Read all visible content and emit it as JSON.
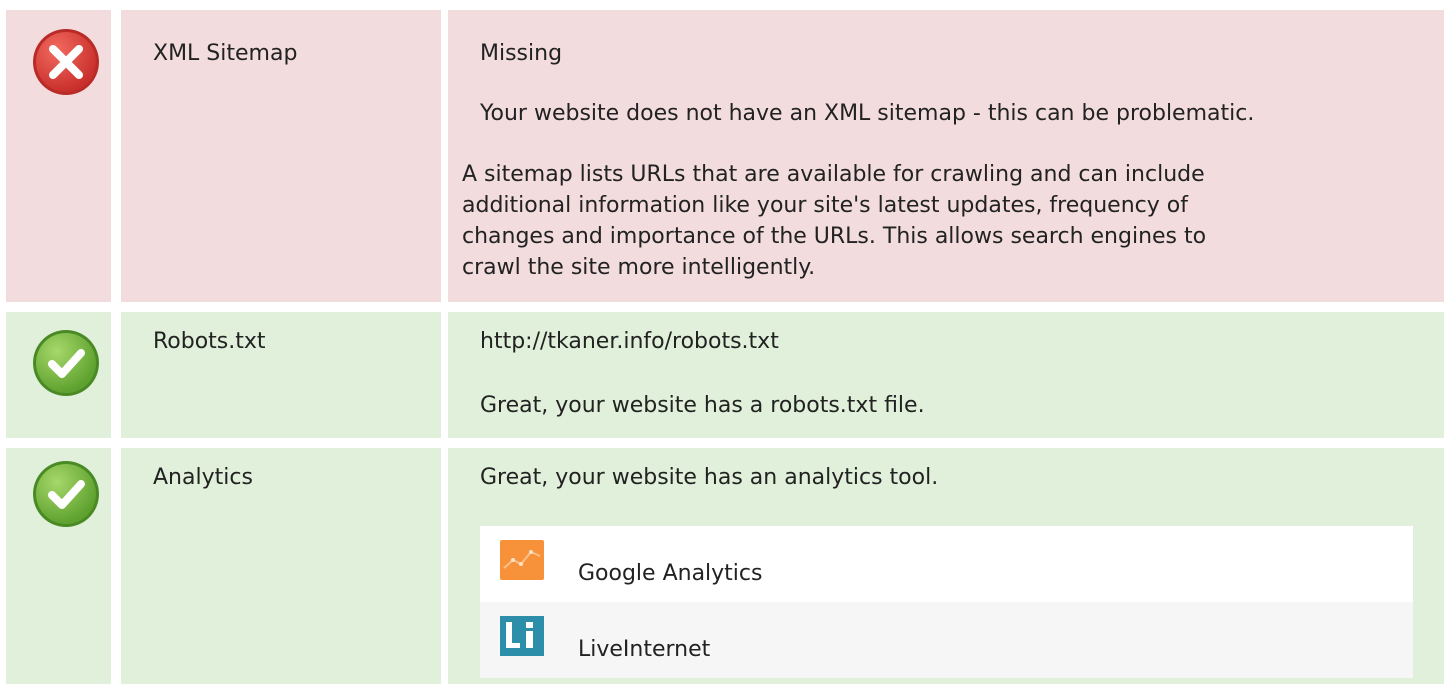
{
  "rows": [
    {
      "status": "fail",
      "status_icon": "red-cross-icon",
      "label": "XML Sitemap",
      "value": "Missing",
      "message": "Your website does not have an XML sitemap - this can be problematic.",
      "description_lines": [
        "A sitemap lists URLs that are available for crawling and can include",
        "additional information like your site's latest updates, frequency of",
        "changes and importance of the URLs. This allows search engines to",
        "crawl the site more intelligently."
      ]
    },
    {
      "status": "pass",
      "status_icon": "green-check-icon",
      "label": "Robots.txt",
      "value": "http://tkaner.info/robots.txt",
      "message": "Great, your website has a robots.txt file."
    },
    {
      "status": "pass",
      "status_icon": "green-check-icon",
      "label": "Analytics",
      "message": "Great, your website has an analytics tool.",
      "tools": [
        {
          "name": "Google Analytics",
          "icon": "google-analytics-icon"
        },
        {
          "name": "LiveInternet",
          "icon": "liveinternet-icon"
        }
      ]
    }
  ],
  "colors": {
    "fail_bg": "#f2dcde",
    "pass_bg": "#e0f0da",
    "fail_icon": "#e2413e",
    "pass_icon": "#7cc242",
    "ga_orange": "#f8923a",
    "li_teal": "#2c8ea8"
  }
}
